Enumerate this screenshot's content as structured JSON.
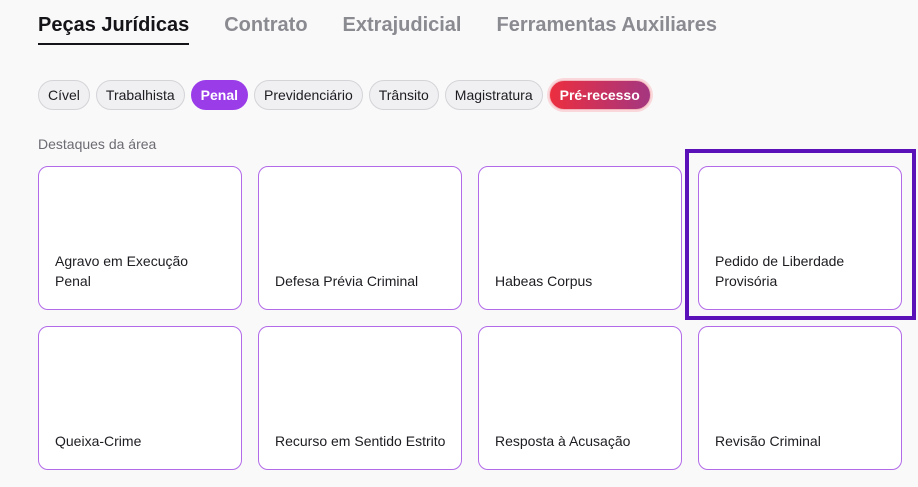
{
  "top_tabs": [
    {
      "label": "Peças Jurídicas",
      "active": true
    },
    {
      "label": "Contrato",
      "active": false
    },
    {
      "label": "Extrajudicial",
      "active": false
    },
    {
      "label": "Ferramentas Auxiliares",
      "active": false
    }
  ],
  "chips": [
    {
      "label": "Cível"
    },
    {
      "label": "Trabalhista"
    },
    {
      "label": "Penal",
      "active": true
    },
    {
      "label": "Previdenciário"
    },
    {
      "label": "Trânsito"
    },
    {
      "label": "Magistratura"
    },
    {
      "label": "Pré-recesso",
      "special": true
    }
  ],
  "section": {
    "title": "Destaques da área"
  },
  "cards": [
    {
      "label": "Agravo em Execução Penal"
    },
    {
      "label": "Defesa Prévia Criminal"
    },
    {
      "label": "Habeas Corpus"
    },
    {
      "label": "Pedido de Liberdade Provisória",
      "highlighted": true
    },
    {
      "label": "Queixa-Crime"
    },
    {
      "label": "Recurso em Sentido Estrito"
    },
    {
      "label": "Resposta à Acusação"
    },
    {
      "label": "Revisão Criminal"
    }
  ],
  "colors": {
    "accent": "#9a3de9",
    "highlight_frame": "#5a12b8",
    "card_border": "#b26ae8",
    "special_chip_start": "#ec2e3f",
    "special_chip_end": "#a43680"
  }
}
